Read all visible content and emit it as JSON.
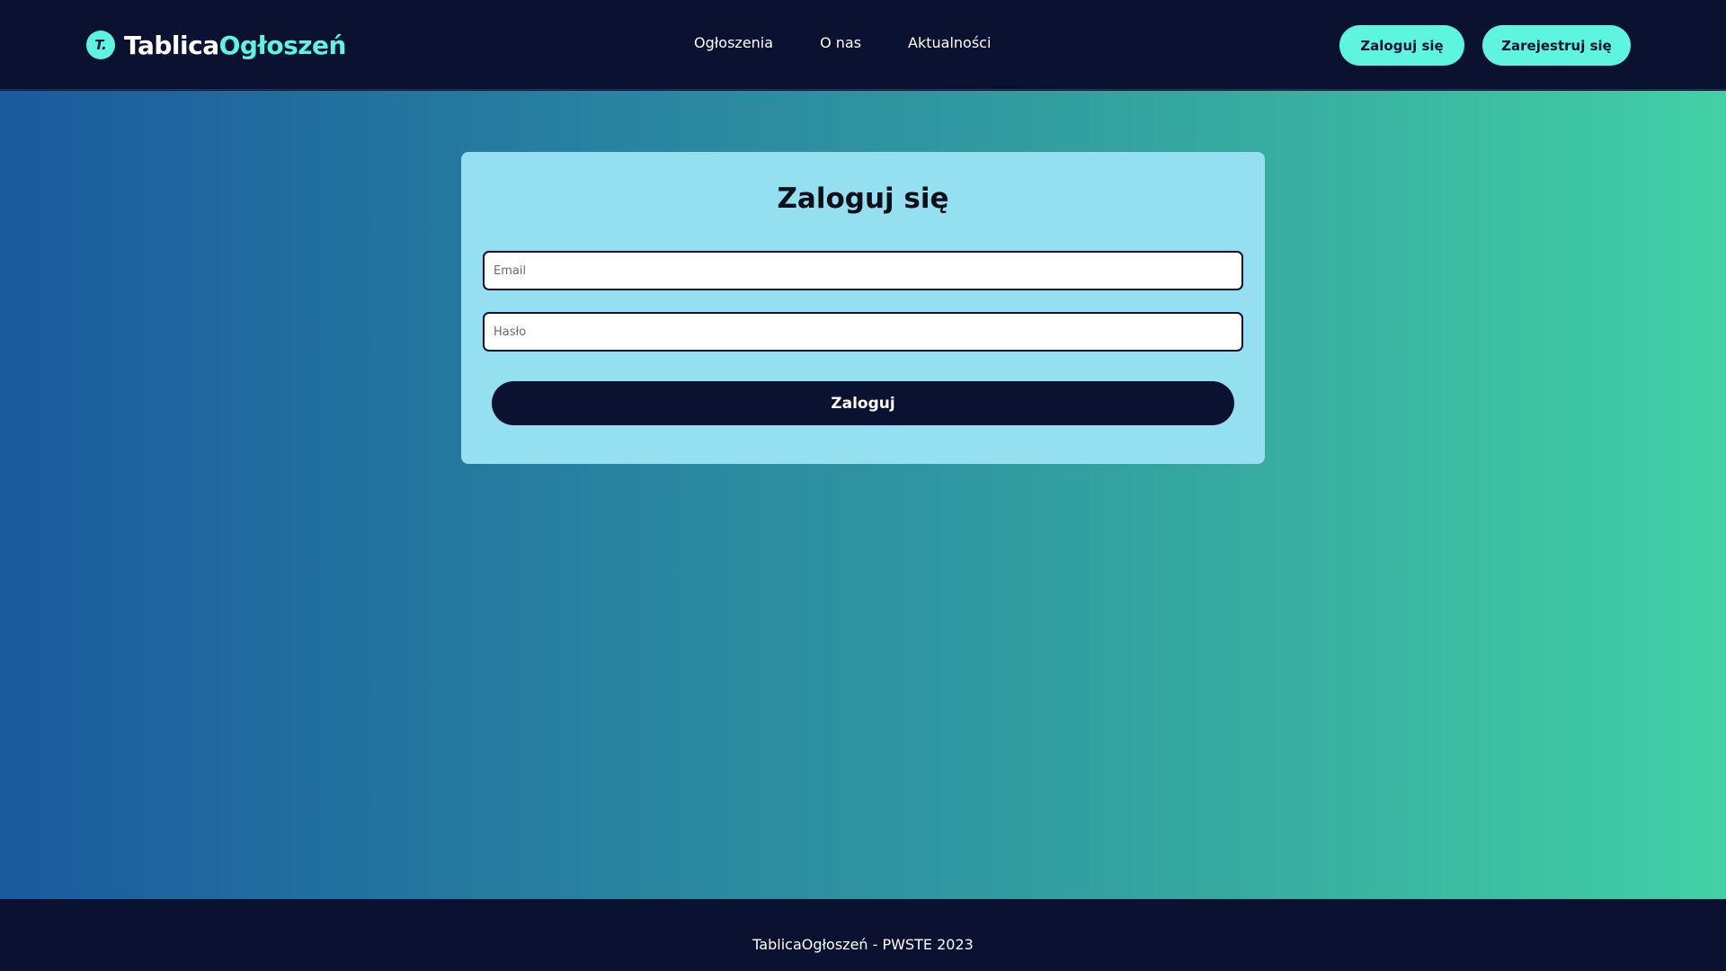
{
  "brand": {
    "badge": "T.",
    "name_primary": "Tablica",
    "name_accent": "Ogłoszeń"
  },
  "nav": {
    "items": [
      {
        "label": "Ogłoszenia"
      },
      {
        "label": "O nas"
      },
      {
        "label": "Aktualności"
      }
    ]
  },
  "auth": {
    "login_label": "Zaloguj się",
    "register_label": "Zarejestruj się"
  },
  "login_form": {
    "title": "Zaloguj się",
    "email_placeholder": "Email",
    "email_value": "",
    "password_placeholder": "Hasło",
    "password_value": "",
    "submit_label": "Zaloguj"
  },
  "footer": {
    "text": "TablicaOgłoszeń - PWSTE 2023"
  },
  "colors": {
    "navy": "#0b1130",
    "accent": "#5ef5e0",
    "card": "#94e0f0",
    "gradient_start": "#1a5a9e",
    "gradient_end": "#42d1a4"
  }
}
